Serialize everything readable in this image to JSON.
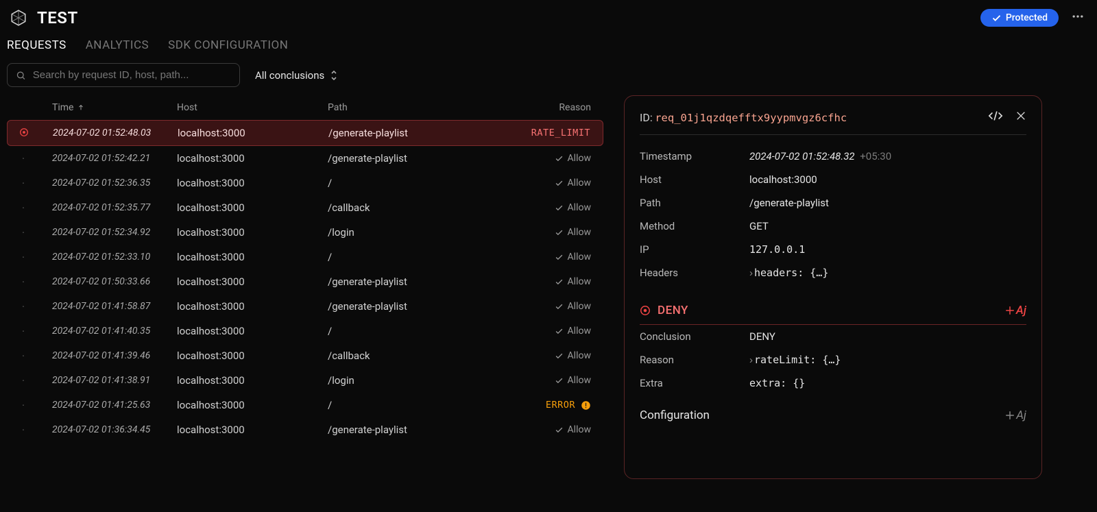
{
  "header": {
    "title": "TEST",
    "protected_label": "Protected"
  },
  "tabs": {
    "requests": "REQUESTS",
    "analytics": "ANALYTICS",
    "sdk": "SDK CONFIGURATION"
  },
  "filters": {
    "search_placeholder": "Search by request ID, host, path...",
    "conclusions_label": "All conclusions"
  },
  "table": {
    "columns": {
      "time": "Time",
      "host": "Host",
      "path": "Path",
      "reason": "Reason"
    },
    "allow_label": "Allow",
    "rows": [
      {
        "time": "2024-07-02 01:52:48.03",
        "host": "localhost:3000",
        "path": "/generate-playlist",
        "reason": "RATE_LIMIT",
        "selected": true
      },
      {
        "time": "2024-07-02 01:52:42.21",
        "host": "localhost:3000",
        "path": "/generate-playlist",
        "reason": "Allow"
      },
      {
        "time": "2024-07-02 01:52:36.35",
        "host": "localhost:3000",
        "path": "/",
        "reason": "Allow"
      },
      {
        "time": "2024-07-02 01:52:35.77",
        "host": "localhost:3000",
        "path": "/callback",
        "reason": "Allow"
      },
      {
        "time": "2024-07-02 01:52:34.92",
        "host": "localhost:3000",
        "path": "/login",
        "reason": "Allow"
      },
      {
        "time": "2024-07-02 01:52:33.10",
        "host": "localhost:3000",
        "path": "/",
        "reason": "Allow"
      },
      {
        "time": "2024-07-02 01:50:33.66",
        "host": "localhost:3000",
        "path": "/generate-playlist",
        "reason": "Allow"
      },
      {
        "time": "2024-07-02 01:41:58.87",
        "host": "localhost:3000",
        "path": "/generate-playlist",
        "reason": "Allow"
      },
      {
        "time": "2024-07-02 01:41:40.35",
        "host": "localhost:3000",
        "path": "/",
        "reason": "Allow"
      },
      {
        "time": "2024-07-02 01:41:39.46",
        "host": "localhost:3000",
        "path": "/callback",
        "reason": "Allow"
      },
      {
        "time": "2024-07-02 01:41:38.91",
        "host": "localhost:3000",
        "path": "/login",
        "reason": "Allow"
      },
      {
        "time": "2024-07-02 01:41:25.63",
        "host": "localhost:3000",
        "path": "/",
        "reason": "ERROR"
      },
      {
        "time": "2024-07-02 01:36:34.45",
        "host": "localhost:3000",
        "path": "/generate-playlist",
        "reason": "Allow"
      }
    ]
  },
  "detail": {
    "id_label": "ID:",
    "id_value": "req_01j1qzdqefftx9yypmvgz6cfhc",
    "timestamp_label": "Timestamp",
    "timestamp_value": "2024-07-02 01:52:48.32",
    "timestamp_tz": "+05:30",
    "host_label": "Host",
    "host_value": "localhost:3000",
    "path_label": "Path",
    "path_value": "/generate-playlist",
    "method_label": "Method",
    "method_value": "GET",
    "ip_label": "IP",
    "ip_value": "127.0.0.1",
    "headers_label": "Headers",
    "headers_value": "headers: {…}",
    "deny_title": "DENY",
    "conclusion_label": "Conclusion",
    "conclusion_value": "DENY",
    "reason_label": "Reason",
    "reason_value": "rateLimit: {…}",
    "extra_label": "Extra",
    "extra_value": "extra: {}",
    "config_title": "Configuration",
    "aj_label": "Aj"
  }
}
